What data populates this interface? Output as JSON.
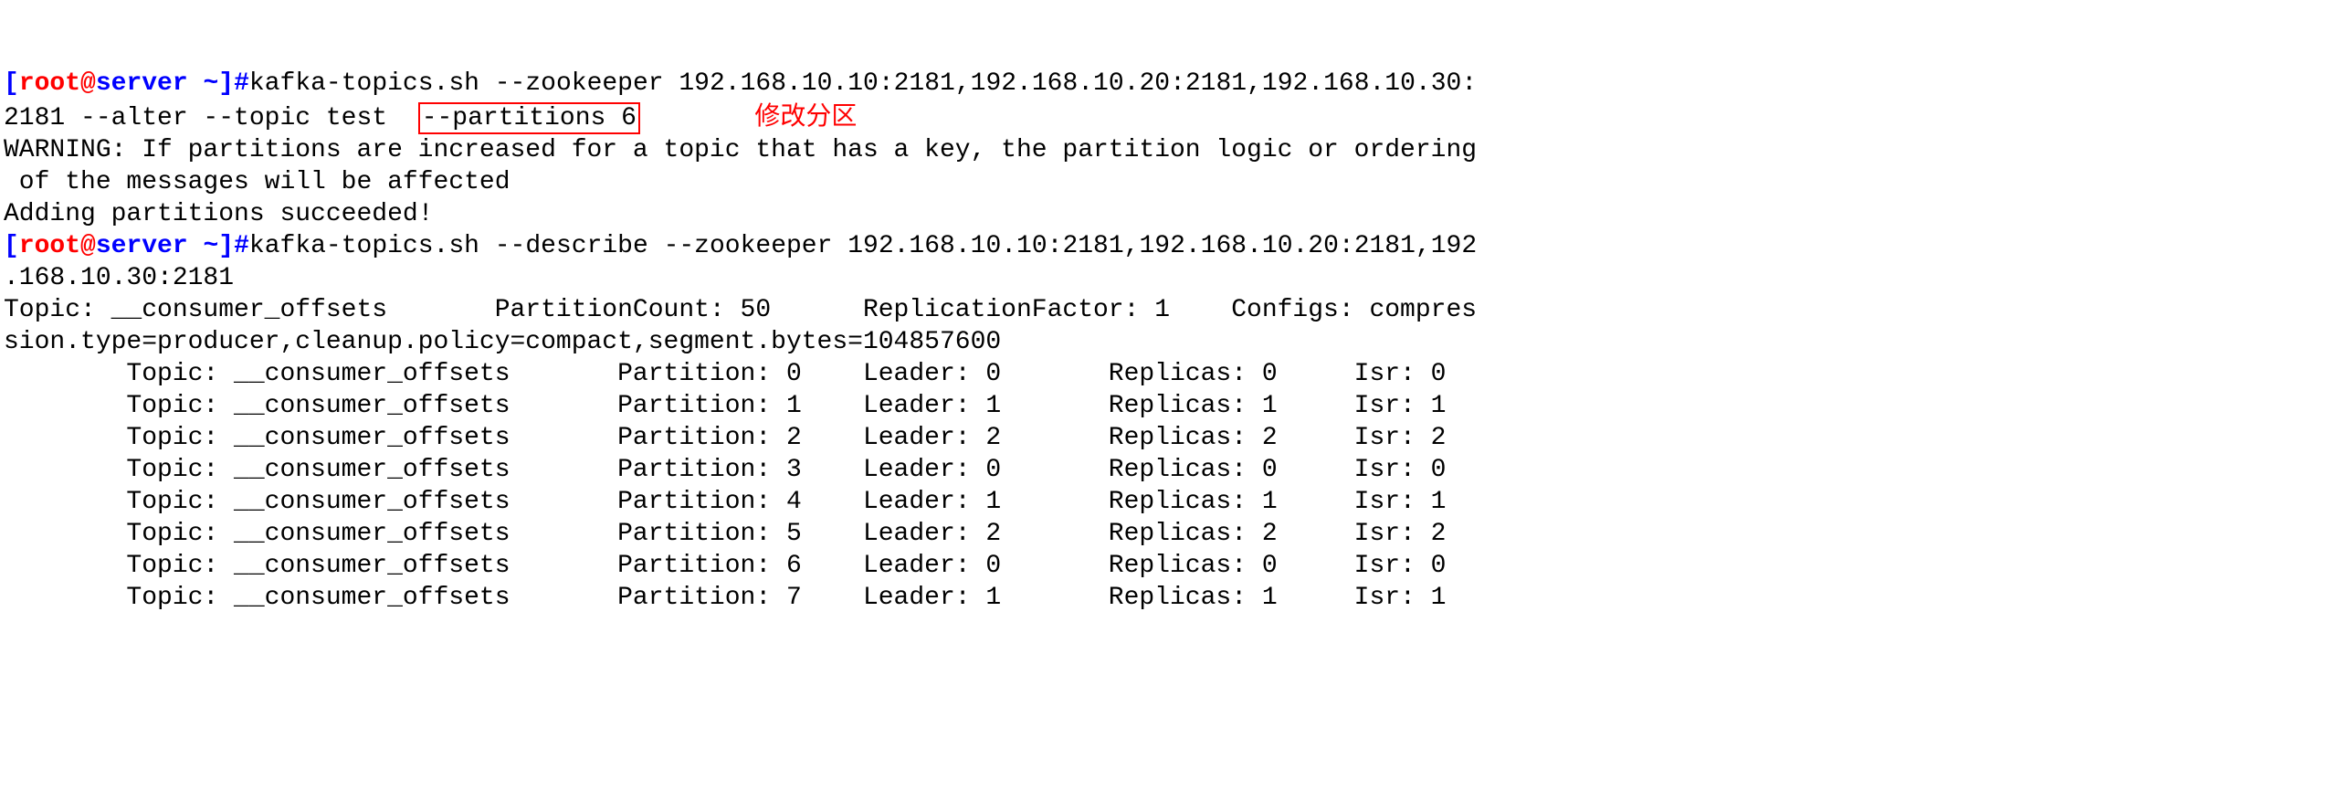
{
  "prompt1": {
    "lbracket": "[",
    "user": "root",
    "at": "@",
    "host": "server",
    "path": " ~",
    "rbracket": "]",
    "hash": "#",
    "cmd_part1": "kafka-topics.sh --zookeeper 192.168.10.10:2181,192.168.10.20:2181,192.168.10.30:",
    "cmd_part2": "2181 --alter --topic test  ",
    "cmd_boxed": "--partitions 6",
    "annotation": " 修改分区"
  },
  "output1": {
    "line1": "WARNING: If partitions are increased for a topic that has a key, the partition logic or ordering",
    "line2": " of the messages will be affected",
    "line3": "Adding partitions succeeded!"
  },
  "prompt2": {
    "lbracket": "[",
    "user": "root",
    "at": "@",
    "host": "server",
    "path": " ~",
    "rbracket": "]",
    "hash": "#",
    "cmd_part1": "kafka-topics.sh --describe --zookeeper 192.168.10.10:2181,192.168.10.20:2181,192",
    "cmd_part2": ".168.10.30:2181"
  },
  "output2": {
    "header1": "Topic: __consumer_offsets       PartitionCount: 50      ReplicationFactor: 1    Configs: compres",
    "header2": "sion.type=producer,cleanup.policy=compact,segment.bytes=104857600",
    "rows": [
      "        Topic: __consumer_offsets       Partition: 0    Leader: 0       Replicas: 0     Isr: 0",
      "        Topic: __consumer_offsets       Partition: 1    Leader: 1       Replicas: 1     Isr: 1",
      "        Topic: __consumer_offsets       Partition: 2    Leader: 2       Replicas: 2     Isr: 2",
      "        Topic: __consumer_offsets       Partition: 3    Leader: 0       Replicas: 0     Isr: 0",
      "        Topic: __consumer_offsets       Partition: 4    Leader: 1       Replicas: 1     Isr: 1",
      "        Topic: __consumer_offsets       Partition: 5    Leader: 2       Replicas: 2     Isr: 2",
      "        Topic: __consumer_offsets       Partition: 6    Leader: 0       Replicas: 0     Isr: 0",
      "        Topic: __consumer_offsets       Partition: 7    Leader: 1       Replicas: 1     Isr: 1"
    ]
  }
}
